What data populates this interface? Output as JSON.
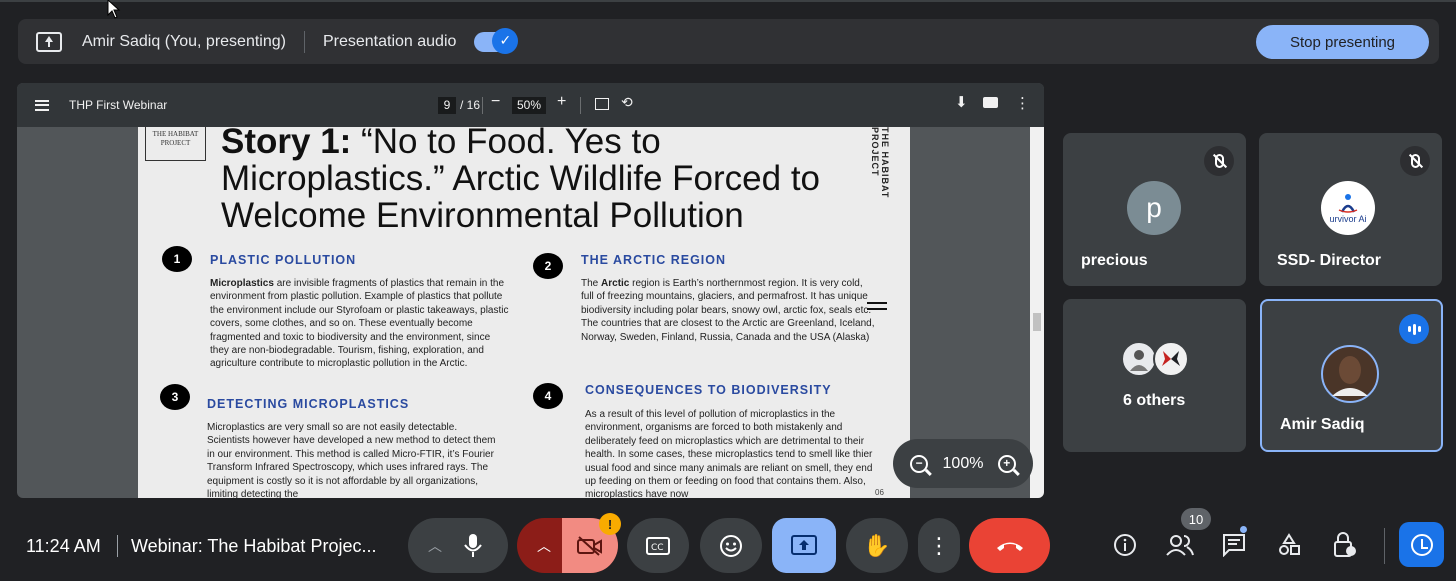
{
  "presenting_bar": {
    "presenter": "Amir Sadiq (You, presenting)",
    "audio_label": "Presentation audio",
    "audio_on": true,
    "stop_label": "Stop presenting"
  },
  "viewer": {
    "doc_title": "THP First Webinar",
    "page_current": "9",
    "page_total": "/ 16",
    "zoom": "50%",
    "zoom_minus": "−",
    "zoom_plus": "+",
    "float_zoom": "100%"
  },
  "page": {
    "logo_text": "THE HABIBAT PROJECT",
    "headline_bold": "Story 1:",
    "headline_rest": " “No to Food. Yes to Microplastics.” Arctic Wildlife Forced to Welcome Environmental Pollution",
    "side_text": "THE HABIBAT PROJECT",
    "page_number": "06",
    "sections": [
      {
        "num": "1",
        "title": "PLASTIC POLLUTION",
        "lead": "Microplastics",
        "body": " are invisible fragments of plastics that remain in the environment from plastic pollution. Example of plastics that pollute the environment include our Styrofoam or plastic takeaways, plastic covers, some clothes, and so on. These eventually become fragmented and toxic to biodiversity and the environment, since they are non-biodegradable. Tourism, fishing, exploration, and agriculture contribute to microplastic pollution in the Arctic."
      },
      {
        "num": "2",
        "title": "THE ARCTIC REGION",
        "lead_pre": "The ",
        "lead": "Arctic",
        "body": " region is Earth’s northernmost region. It is very cold, full of freezing mountains, glaciers, and permafrost. It has unique biodiversity including polar bears, snowy owl, arctic fox, seals etc. The countries that are closest to the Arctic are Greenland, Iceland, Norway, Sweden, Finland, Russia, Canada and the USA (Alaska)"
      },
      {
        "num": "3",
        "title": "DETECTING MICROPLASTICS",
        "body": "Microplastics are very small so are not easily detectable. Scientists however have developed a new method to detect them in our environment. This method is called Micro-FTIR, it’s Fourier Transform Infrared Spectroscopy, which uses infrared rays. The equipment is costly so it is not affordable by all organizations, limiting detecting the"
      },
      {
        "num": "4",
        "title": "CONSEQUENCES TO BIODIVERSITY",
        "body": "As a result of this level of pollution of microplastics in the environment, organisms are forced to both mistakenly and deliberately feed on microplastics which are detrimental to their health. In some cases, these microplastics tend to smell like thier usual food and since many animals are reliant on smell, they end up feeding on them or feeding on food that contains them. Also, microplastics have now"
      }
    ]
  },
  "participants": [
    {
      "name": "precious",
      "initial": "p",
      "avatar_color": "#7b8c94",
      "muted": true
    },
    {
      "name": "SSD- Director",
      "avatar_text": "urvivor Ai",
      "muted": true
    },
    {
      "name": "6 others"
    },
    {
      "name": "Amir Sadiq",
      "speaking": true
    }
  ],
  "bottom_bar": {
    "time": "11:24 AM",
    "meeting_title": "Webinar: The Habibat Projec...",
    "people_count": "10",
    "camera_warning": "!"
  },
  "colors": {
    "accent": "#8ab4f8",
    "blue": "#1a73e8",
    "end_call": "#ea4335",
    "camera_off": "#f28b82"
  }
}
